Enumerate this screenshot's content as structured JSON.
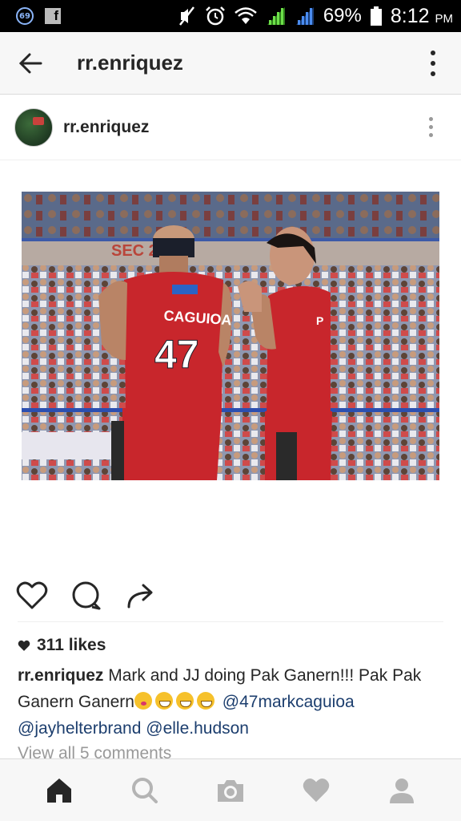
{
  "status_bar": {
    "notification_badge": "69",
    "facebook_label": "f",
    "battery": "69%",
    "time": "8:12",
    "time_suffix": "PM"
  },
  "app_bar": {
    "title": "rr.enriquez",
    "back_icon": "arrow-left-icon",
    "more_icon": "more-vertical-icon"
  },
  "post": {
    "username": "rr.enriquez",
    "likes": "311 likes",
    "caption": {
      "username": "rr.enriquez",
      "text": "Mark and JJ doing Pak Ganern!!! Pak Pak Ganern Ganern",
      "mention1": "@47markcaguioa",
      "mention2": "@jayhelterbrand",
      "mention3": "@elle.hudson"
    },
    "comments_link": "View all 5 comments",
    "photo_text": {
      "left_jersey_name": "CAGUIOA",
      "left_jersey_number": "47",
      "sign": "SEC 203"
    }
  },
  "bottom_nav": [
    "home-icon",
    "search-icon",
    "camera-icon",
    "heart-icon",
    "profile-icon"
  ],
  "colors": {
    "accent": "#1c3e6e",
    "bar_bg": "#f7f7f7",
    "jersey": "#c8262c"
  }
}
